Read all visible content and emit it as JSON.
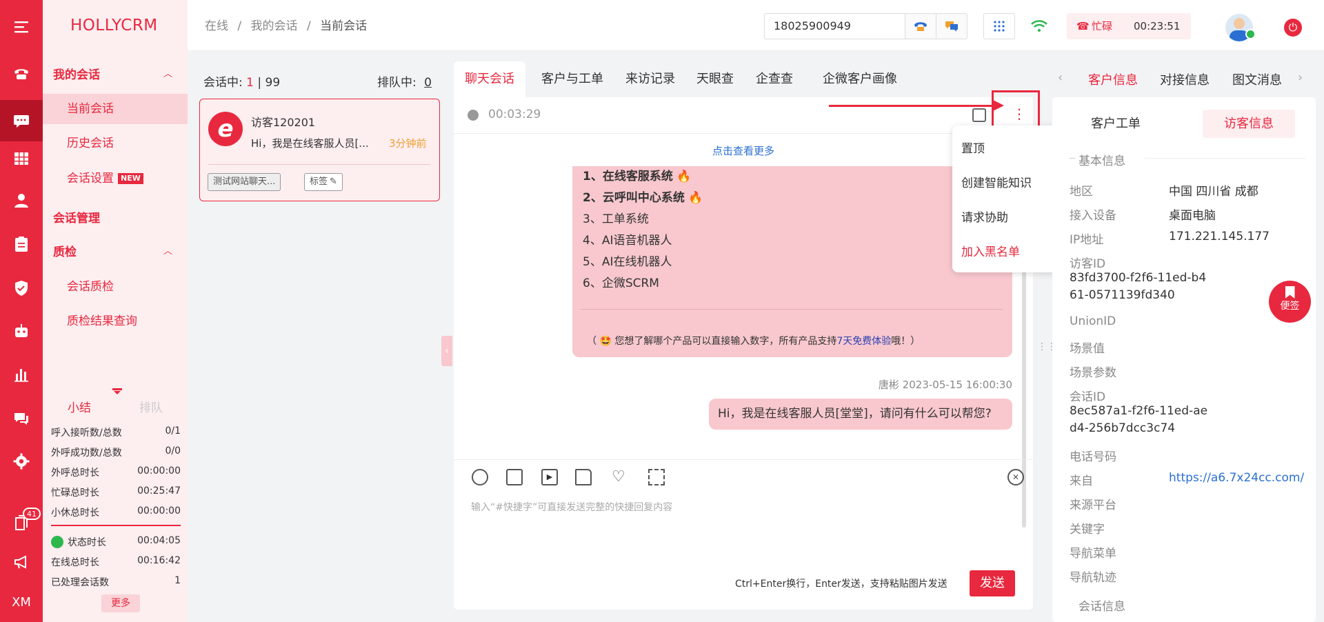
{
  "brand": {
    "logo": "HOLLYCRM",
    "accent": "#e8283e"
  },
  "rail": {
    "badge": "41",
    "xm": "XM"
  },
  "menu": {
    "groups": [
      {
        "label": "我的会话"
      },
      {
        "label": "会话管理"
      },
      {
        "label": "质检"
      }
    ],
    "items": [
      {
        "label": "当前会话"
      },
      {
        "label": "历史会话"
      },
      {
        "label": "会话设置"
      },
      {
        "label": "会话质检"
      },
      {
        "label": "质检结果查询"
      }
    ],
    "new_tag": "NEW"
  },
  "summary": {
    "tab_active": "小结",
    "tab_inactive": "排队",
    "rows": [
      {
        "label": "呼入接听数/总数",
        "value": "0/1"
      },
      {
        "label": "外呼成功数/总数",
        "value": "0/0"
      },
      {
        "label": "外呼总时长",
        "value": "00:00:00"
      },
      {
        "label": "忙碌总时长",
        "value": "00:25:47"
      },
      {
        "label": "小休总时长",
        "value": "00:00:00"
      }
    ],
    "rows2": [
      {
        "label": "状态时长",
        "value": "00:04:05"
      },
      {
        "label": "在线总时长",
        "value": "00:16:42"
      },
      {
        "label": "已处理会话数",
        "value": "1"
      }
    ],
    "more": "更多"
  },
  "topbar": {
    "crumbs": [
      "在线",
      "我的会话",
      "当前会话"
    ],
    "sep": "/",
    "phone": "18025900949",
    "status": "忙碌",
    "timer": "00:23:51"
  },
  "sessions": {
    "active_label": "会话中:",
    "active_count": "1",
    "total": "| 99",
    "queue_label": "排队中:",
    "queue_count": "0",
    "card": {
      "name": "访客120201",
      "msg": "Hi，我是在线客服人员[...",
      "time": "3分钟前",
      "chip1": "测试网站聊天...",
      "chip2": "标签"
    }
  },
  "chat": {
    "tabs": [
      "聊天会话",
      "客户与工单",
      "来访记录",
      "天眼查",
      "企查查",
      "企微客户画像"
    ],
    "duration": "00:03:29",
    "view_more": "点击查看更多",
    "lines": [
      {
        "t": "1、在线客服系统",
        "bold": true,
        "fire": true
      },
      {
        "t": "2、云呼叫中心系统",
        "bold": true,
        "fire": true
      },
      {
        "t": "3、工单系统"
      },
      {
        "t": "4、AI语音机器人"
      },
      {
        "t": "5、AI在线机器人"
      },
      {
        "t": "6、企微SCRM"
      }
    ],
    "hint_pre": "（ 🤩 您想了解哪个产品可以直接输入数字，所有产品支持",
    "hint_hl": "7天免费体验",
    "hint_post": "哦！）",
    "sender": "唐彬 2023-05-15 16:00:30",
    "my_msg": "Hi，我是在线客服人员[堂堂]，请问有什么可以帮您?",
    "placeholder": "输入“#快捷字”可直接发送完整的快捷回复内容",
    "send_hint": "Ctrl+Enter换行，Enter发送，支持粘贴图片发送",
    "send": "发送",
    "menu": [
      "置顶",
      "创建智能知识",
      "请求协助",
      "加入黑名单"
    ]
  },
  "right": {
    "tabs": [
      "客户信息",
      "对接信息",
      "图文消息"
    ],
    "subtabs": [
      "客户工单",
      "访客信息"
    ],
    "section": "基本信息",
    "fields": [
      {
        "label": "地区",
        "value": "中国 四川省 成都"
      },
      {
        "label": "接入设备",
        "value": "桌面电脑"
      },
      {
        "label": "IP地址",
        "value": "171.221.145.177"
      },
      {
        "label": "访客ID",
        "value": "83fd3700-f2f6-11ed-b4",
        "value2": "61-0571139fd340"
      },
      {
        "label": "UnionID",
        "value": ""
      },
      {
        "label": "场景值",
        "value": ""
      },
      {
        "label": "场景参数",
        "value": ""
      },
      {
        "label": "会话ID",
        "value": "8ec587a1-f2f6-11ed-ae",
        "value2": "d4-256b7dcc3c74"
      },
      {
        "label": "电话号码",
        "value": ""
      },
      {
        "label": "来自",
        "value": "https://a6.7x24cc.com/"
      },
      {
        "label": "来源平台",
        "value": ""
      },
      {
        "label": "关键字",
        "value": ""
      },
      {
        "label": "导航菜单",
        "value": ""
      },
      {
        "label": "导航轨迹",
        "value": ""
      }
    ],
    "cut_section": "会话信息",
    "float": "便签"
  }
}
